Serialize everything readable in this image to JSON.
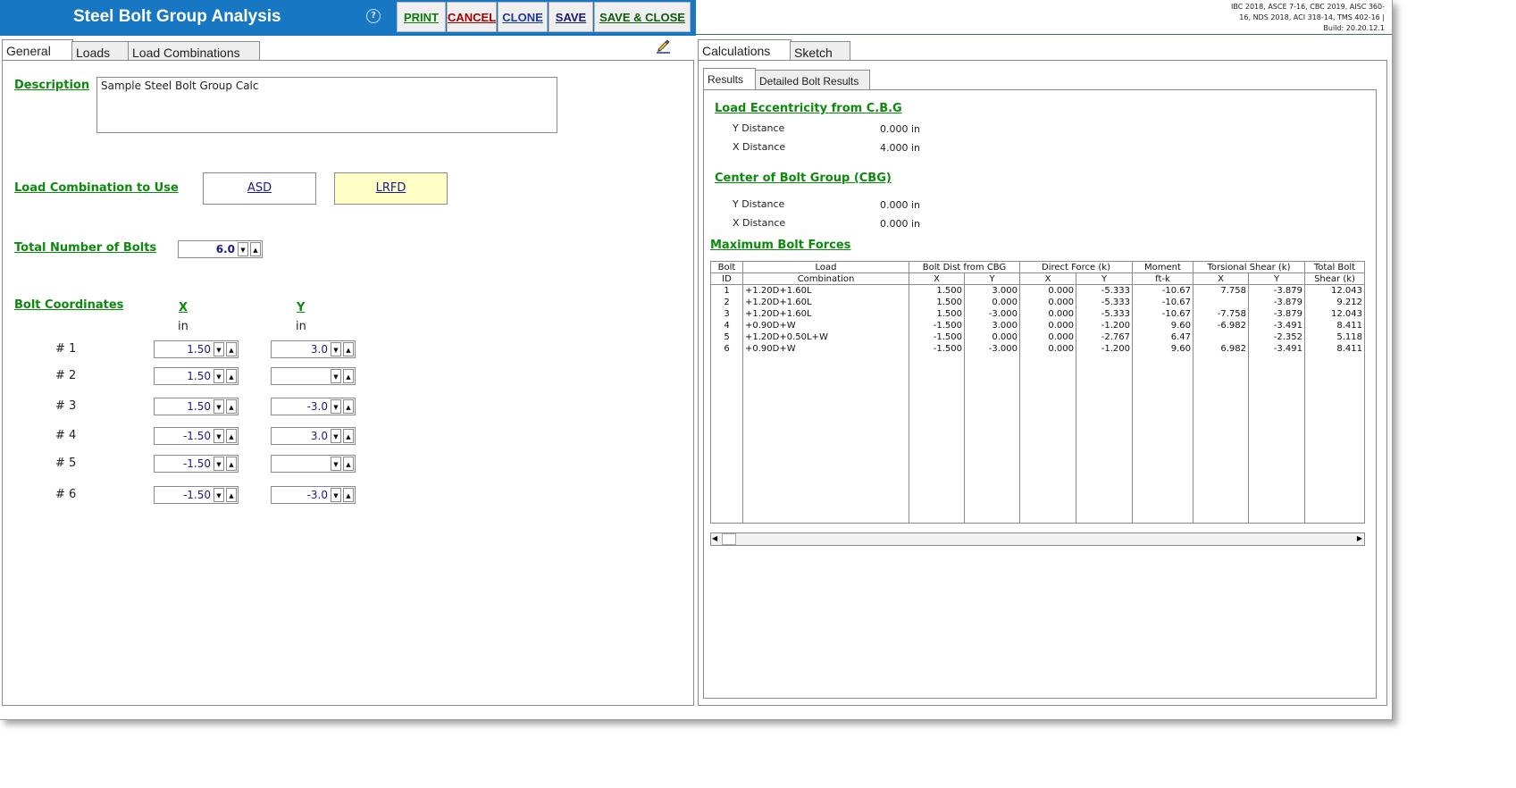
{
  "header": {
    "title": "Steel Bolt Group Analysis",
    "help_symbol": "?",
    "buttons": {
      "print": "PRINT",
      "cancel": "CANCEL",
      "clone": "CLONE",
      "save": "SAVE",
      "save_close": "SAVE & CLOSE"
    },
    "button_colors": {
      "print": "#0c7a0c",
      "cancel": "#a00000",
      "clone": "#1a3a9a",
      "save": "#1a1a6a",
      "save_close": "#0c5a0c"
    },
    "codes": [
      "IBC 2018, ASCE 7-16, CBC 2019, AISC 360-",
      "16, NDS 2018, ACI 318-14, TMS 402-16 |",
      "Build: 20.20.12.1"
    ]
  },
  "left_tabs": [
    "General",
    "Loads",
    "Load Combinations"
  ],
  "general": {
    "description_label": "Description",
    "description_value": "Sample Steel Bolt Group Calc",
    "load_combo_label": "Load Combination to Use",
    "asd": "ASD",
    "lrfd": "LRFD",
    "selected_color": "#ffffc6",
    "num_bolts_label": "Total Number of Bolts",
    "num_bolts": "6.0",
    "bolt_coords_label": "Bolt Coordinates",
    "x_header": "X",
    "y_header": "Y",
    "x_unit": "in",
    "y_unit": "in",
    "bolts": [
      {
        "label": "# 1",
        "x": "1.50",
        "y": "3.0"
      },
      {
        "label": "# 2",
        "x": "1.50",
        "y": ""
      },
      {
        "label": "# 3",
        "x": "1.50",
        "y": "-3.0"
      },
      {
        "label": "# 4",
        "x": "-1.50",
        "y": "3.0"
      },
      {
        "label": "# 5",
        "x": "-1.50",
        "y": ""
      },
      {
        "label": "# 6",
        "x": "-1.50",
        "y": "-3.0"
      }
    ]
  },
  "right_tabs": [
    "Calculations",
    "Sketch"
  ],
  "sub_tabs": [
    "Results",
    "Detailed Bolt Results"
  ],
  "results": {
    "ecc_title": "Load Eccentricity from C.B.G",
    "ecc_y_label": "Y Distance",
    "ecc_y": "0.000 in",
    "ecc_x_label": "X Distance",
    "ecc_x": "4.000 in",
    "cbg_title": "Center of Bolt Group (CBG)",
    "cbg_y_label": "Y Distance",
    "cbg_y": "0.000 in",
    "cbg_x_label": "X Distance",
    "cbg_x": "0.000 in",
    "forces_title": "Maximum Bolt Forces",
    "head1": [
      "Bolt",
      "Load",
      "Bolt Dist from CBG",
      "Direct Force  (k)",
      "Moment",
      "Torsional Shear  (k)",
      "Total Bolt"
    ],
    "head2": [
      "ID",
      "Combination",
      "X",
      "Y",
      "X",
      "Y",
      "ft-k",
      "X",
      "Y",
      "Shear  (k)"
    ],
    "rows": [
      [
        "1",
        "+1.20D+1.60L",
        "1.500",
        "3.000",
        "0.000",
        "-5.333",
        "-10.67",
        "7.758",
        "-3.879",
        "12.043"
      ],
      [
        "2",
        "+1.20D+1.60L",
        "1.500",
        "0.000",
        "0.000",
        "-5.333",
        "-10.67",
        "",
        "-3.879",
        "9.212"
      ],
      [
        "3",
        "+1.20D+1.60L",
        "1.500",
        "-3.000",
        "0.000",
        "-5.333",
        "-10.67",
        "-7.758",
        "-3.879",
        "12.043"
      ],
      [
        "4",
        "+0.90D+W",
        "-1.500",
        "3.000",
        "0.000",
        "-1.200",
        "9.60",
        "-6.982",
        "-3.491",
        "8.411"
      ],
      [
        "5",
        "+1.20D+0.50L+W",
        "-1.500",
        "0.000",
        "0.000",
        "-2.767",
        "6.47",
        "",
        "-2.352",
        "5.118"
      ],
      [
        "6",
        "+0.90D+W",
        "-1.500",
        "-3.000",
        "0.000",
        "-1.200",
        "9.60",
        "6.982",
        "-3.491",
        "8.411"
      ]
    ]
  }
}
